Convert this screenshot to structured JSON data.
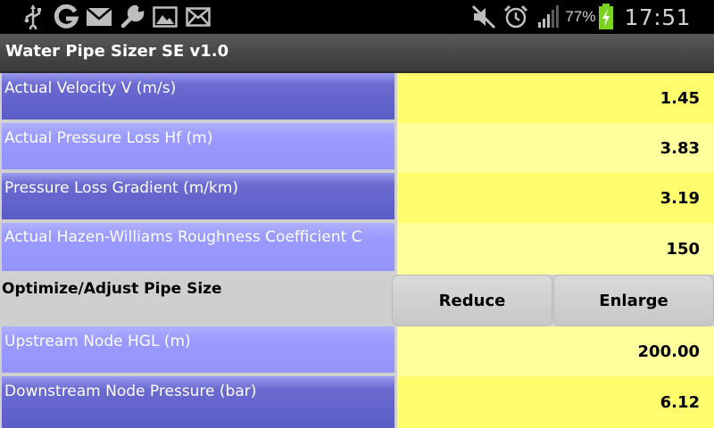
{
  "status_bar": {
    "battery_pct": "77%",
    "time": "17:51",
    "icons_left": [
      "usb-icon",
      "google-icon",
      "gmail-icon",
      "wrench-icon",
      "gallery-icon",
      "mail-icon"
    ],
    "icons_right": [
      "mute-icon",
      "alarm-icon",
      "signal-icon",
      "battery-charging-icon"
    ]
  },
  "app": {
    "title": "Water Pipe Sizer SE v1.0"
  },
  "results": [
    {
      "label": "Actual Velocity V (m/s)",
      "value": "1.45"
    },
    {
      "label": "Actual Pressure Loss Hf (m)",
      "value": "3.83"
    },
    {
      "label": "Pressure Loss Gradient (m/km)",
      "value": "3.19"
    },
    {
      "label": "Actual Hazen-Williams Roughness Coefficient C",
      "value": "150"
    }
  ],
  "optimize": {
    "label": "Optimize/Adjust Pipe Size",
    "reduce_label": "Reduce",
    "enlarge_label": "Enlarge"
  },
  "nodes": [
    {
      "label": "Upstream Node HGL (m)",
      "value": "200.00"
    },
    {
      "label": "Downstream Node Pressure (bar)",
      "value": "6.12"
    }
  ],
  "colors": {
    "label_dark": "#5c5cc8",
    "label_light": "#9494f8",
    "value_yellow": "#ffff6e",
    "value_pale_yellow": "#ffff9c",
    "battery_green": "#7bd31f"
  }
}
